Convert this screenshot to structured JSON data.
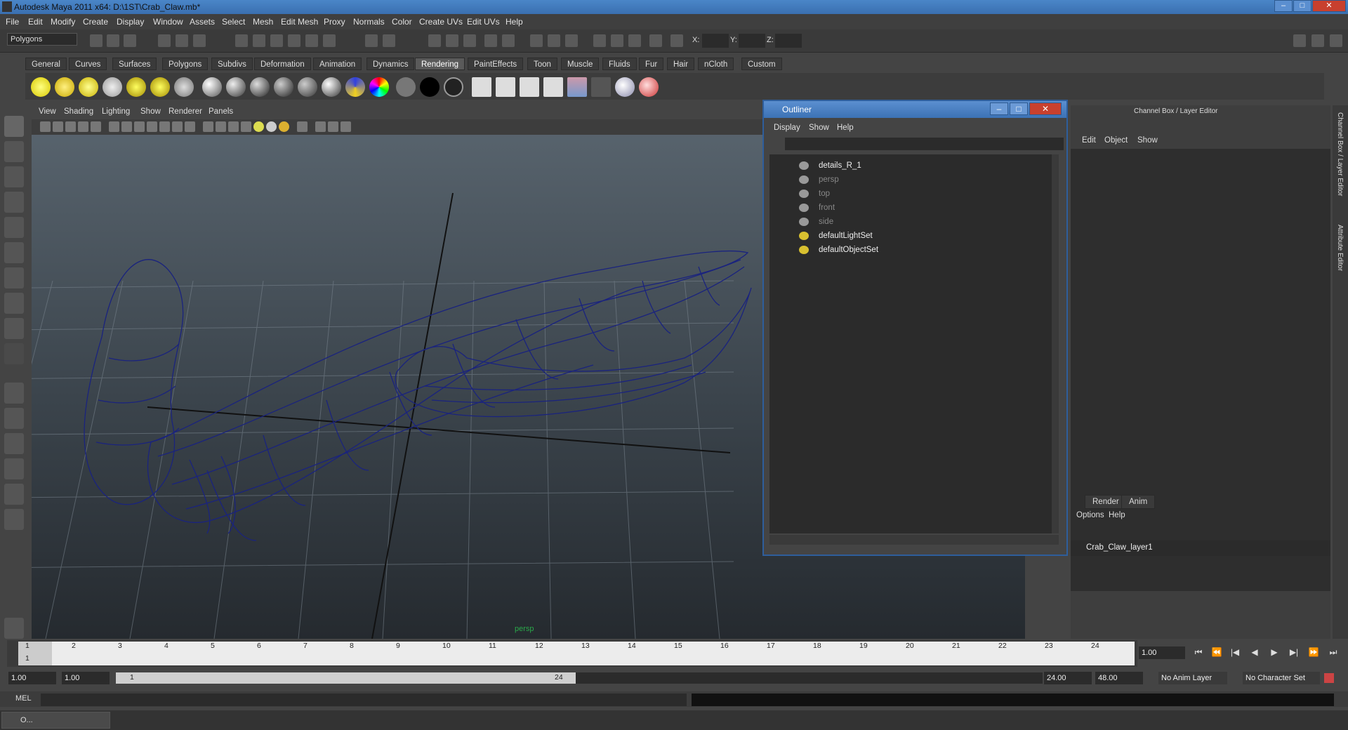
{
  "window": {
    "title": "Autodesk Maya 2011 x64: D:\\1ST\\Crab_Claw.mb*",
    "controls": [
      "–",
      "□",
      "✕"
    ]
  },
  "menubar": [
    "File",
    "Edit",
    "Modify",
    "Create",
    "Display",
    "Window",
    "Assets",
    "Select",
    "Mesh",
    "Edit Mesh",
    "Proxy",
    "Normals",
    "Color",
    "Create UVs",
    "Edit UVs",
    "Help"
  ],
  "status_line": {
    "mode": "Polygons",
    "coord_labels": [
      "X:",
      "Y:",
      "Z:"
    ]
  },
  "shelf_tabs": [
    "General",
    "Curves",
    "Surfaces",
    "Polygons",
    "Subdivs",
    "Deformation",
    "Animation",
    "Dynamics",
    "Rendering",
    "PaintEffects",
    "Toon",
    "Muscle",
    "Fluids",
    "Fur",
    "Hair",
    "nCloth",
    "Custom"
  ],
  "active_shelf_tab": "Rendering",
  "viewport": {
    "menu": [
      "View",
      "Shading",
      "Lighting",
      "Show",
      "Renderer",
      "Panels"
    ],
    "camera_label": "persp",
    "wire_color": "#1a237e"
  },
  "outliner": {
    "title": "Outliner",
    "menu": [
      "Display",
      "Show",
      "Help"
    ],
    "items": [
      {
        "label": "details_R_1",
        "dim": false,
        "icon": "transform-icon"
      },
      {
        "label": "persp",
        "dim": true,
        "icon": "camera-icon"
      },
      {
        "label": "top",
        "dim": true,
        "icon": "camera-icon"
      },
      {
        "label": "front",
        "dim": true,
        "icon": "camera-icon"
      },
      {
        "label": "side",
        "dim": true,
        "icon": "camera-icon"
      },
      {
        "label": "defaultLightSet",
        "dim": false,
        "icon": "set-icon"
      },
      {
        "label": "defaultObjectSet",
        "dim": false,
        "icon": "set-icon"
      }
    ]
  },
  "channel_box": {
    "title": "Channel Box / Layer Editor",
    "menu": [
      "Edit",
      "Object",
      "Show"
    ],
    "layer_tabs": [
      "Render",
      "Anim"
    ],
    "layer_menu": [
      "Options",
      "Help"
    ],
    "layers": [
      "Crab_Claw_layer1"
    ],
    "side_tabs": [
      "Channel Box / Layer Editor",
      "Attribute Editor"
    ]
  },
  "timeline": {
    "frames": [
      "1",
      "2",
      "3",
      "4",
      "5",
      "6",
      "7",
      "8",
      "9",
      "10",
      "11",
      "12",
      "13",
      "14",
      "15",
      "16",
      "17",
      "18",
      "19",
      "20",
      "21",
      "22",
      "23",
      "24"
    ],
    "current_frame": "1",
    "current_time_field": "1.00"
  },
  "range": {
    "start": "1.00",
    "playback_start": "1.00",
    "slider_start": "1",
    "slider_end": "24",
    "playback_end": "24.00",
    "end": "48.00",
    "anim_layer": "No Anim Layer",
    "character_set": "No Character Set"
  },
  "command_line": {
    "label": "MEL"
  },
  "taskbar": {
    "label": "O..."
  }
}
